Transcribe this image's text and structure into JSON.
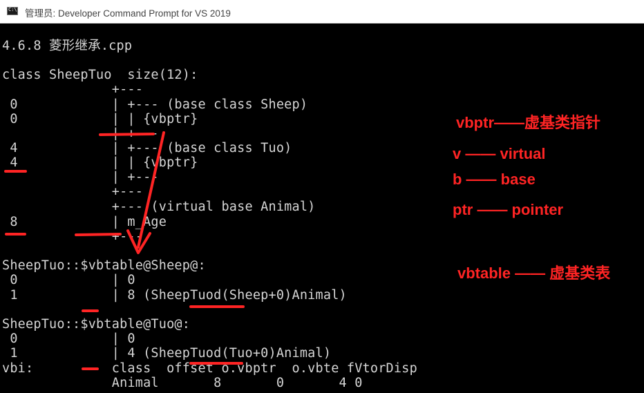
{
  "window": {
    "title": "管理员: Developer Command Prompt for VS 2019",
    "icon": "console-icon"
  },
  "console": {
    "lines": [
      "4.6.8 菱形继承.cpp",
      "",
      "class SheepTuo  size(12):",
      "              +---",
      " 0            | +--- (base class Sheep)",
      " 0            | | {vbptr}",
      "              | +---",
      " 4            | +--- (base class Tuo)",
      " 4            | | {vbptr}",
      "              | +---",
      "              +---",
      "              +--- (virtual base Animal)",
      " 8            | m_Age",
      "              +---",
      "SheepTuo::$vbtable@Sheep@:",
      " 0            | 0",
      " 1            | 8 (SheepTuod(Sheep+0)Animal)",
      "SheepTuo::$vbtable@Tuo@:",
      " 0            | 0",
      " 1            | 4 (SheepTuod(Tuo+0)Animal)",
      "vbi:          class  offset o.vbptr  o.vbte fVtorDisp",
      "              Animal       8       0       4 0"
    ]
  },
  "annotations": {
    "vbptr": "vbptr——虚基类指针",
    "v": "v —— virtual",
    "b": "b —— base",
    "ptr": "ptr —— pointer",
    "vbtable": "vbtable —— 虚基类表"
  },
  "colors": {
    "background": "#000000",
    "text": "#d6d6d6",
    "annotation": "#ff2424",
    "titlebar": "#ffffff"
  }
}
